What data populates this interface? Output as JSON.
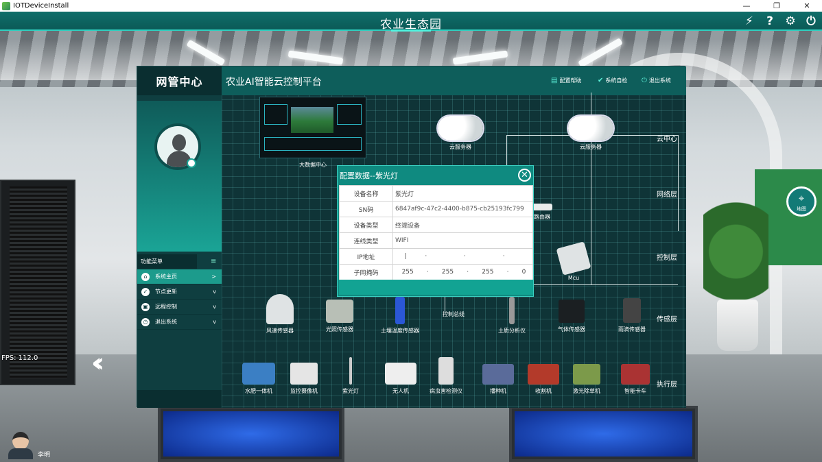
{
  "window": {
    "title": "IOTDeviceInstall",
    "controls": [
      "—",
      "❐",
      "✕"
    ]
  },
  "app": {
    "title": "农业生态园",
    "icons": [
      "lightning-icon",
      "help-icon",
      "settings-icon",
      "power-icon"
    ]
  },
  "panel": {
    "center_title": "网管中心",
    "platform_title": "农业AI智能云控制平台",
    "top_links": [
      {
        "label": "配置帮助",
        "icon": "help-book-icon"
      },
      {
        "label": "系统自检",
        "icon": "check-icon"
      },
      {
        "label": "退出系统",
        "icon": "power-icon"
      }
    ],
    "menu_title": "功能菜单",
    "menu": [
      {
        "label": "系统主页",
        "icon": "home-icon",
        "arrow": ">",
        "active": true
      },
      {
        "label": "节点更新",
        "icon": "shield-icon",
        "arrow": "v"
      },
      {
        "label": "远程控制",
        "icon": "monitor-icon",
        "arrow": "v"
      },
      {
        "label": "退出系统",
        "icon": "clock-icon",
        "arrow": "v"
      }
    ],
    "layers": [
      "云中心",
      "网络层",
      "控制层",
      "传感层",
      "执行层"
    ],
    "nodes": {
      "big_data": "大数据中心",
      "cloud1": "云服务器",
      "cloud2": "云服务器",
      "router_partial": "路由器",
      "mcu": "Mcu",
      "bus": "控制总线"
    },
    "sensors": [
      "风速传感器",
      "光照传感器",
      "土壤温度传感器",
      "土质分析仪",
      "气体传感器",
      "雨滴传感器"
    ],
    "actuators": [
      "水肥一体机",
      "监控摄像机",
      "紫光灯",
      "无人机",
      "病虫害检测仪",
      "播种机",
      "收割机",
      "激光除草机",
      "智能卡车"
    ]
  },
  "dialog": {
    "title": "配置数据--紫光灯",
    "rows": [
      {
        "key": "设备名称",
        "value": "紫光灯"
      },
      {
        "key": "SN码",
        "value": "6847af9c-47c2-4400-b875-cb25193fc799"
      },
      {
        "key": "设备类型",
        "value": "终端设备"
      },
      {
        "key": "连线类型",
        "value": "WIFI"
      }
    ],
    "ip_label": "IP地址",
    "ip_values": [
      "|",
      "",
      "",
      ""
    ],
    "mask_label": "子网掩码",
    "mask_values": [
      "255",
      "255",
      "255",
      "0"
    ]
  },
  "hud": {
    "fps": "FPS: 112.0",
    "user": "李明",
    "map_button": "地图"
  }
}
